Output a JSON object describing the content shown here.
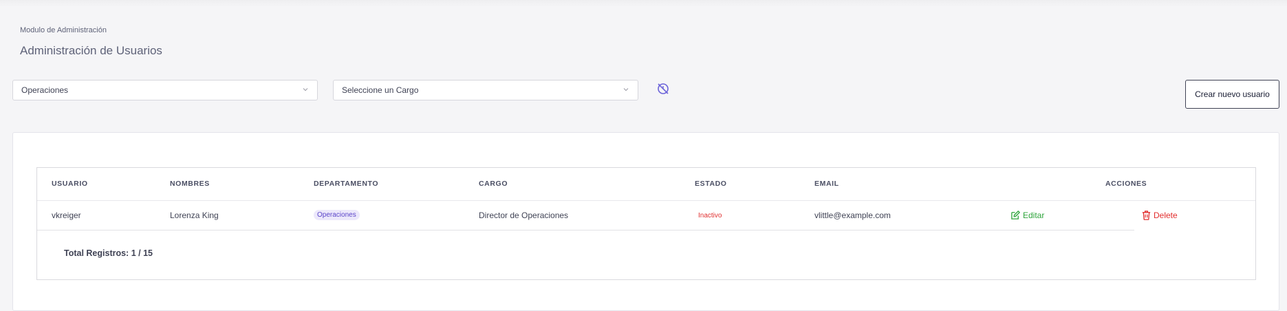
{
  "header": {
    "breadcrumb": "Modulo de Administración",
    "title": "Administración de Usuarios"
  },
  "filters": {
    "department_value": "Operaciones",
    "cargo_placeholder": "Seleccione un Cargo",
    "create_button": "Crear nuevo usuario"
  },
  "table": {
    "columns": [
      "USUARIO",
      "NOMBRES",
      "DEPARTAMENTO",
      "CARGO",
      "ESTADO",
      "EMAIL",
      "ACCIONES"
    ],
    "rows": [
      {
        "usuario": "vkreiger",
        "nombres": "Lorenza King",
        "departamento": "Operaciones",
        "cargo": "Director de Operaciones",
        "estado": "Inactivo",
        "email": "vlittle@example.com",
        "edit_label": "Editar",
        "delete_label": "Delete"
      }
    ],
    "total_label": "Total Registros:",
    "total_value": "1 / 15"
  },
  "colors": {
    "edit": "#2ea43b",
    "delete": "#e22c2c",
    "status_inactive": "#e03030",
    "badge_bg": "#ece8fb",
    "accent_icon": "#6c63d9"
  },
  "icons": [
    "chevron-down-icon",
    "filter-reset-icon",
    "edit-icon",
    "trash-icon"
  ]
}
